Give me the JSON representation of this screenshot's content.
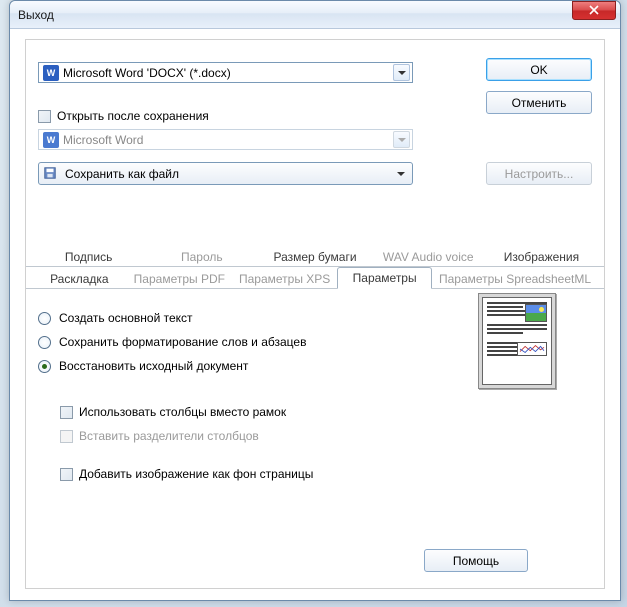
{
  "window": {
    "title": "Выход"
  },
  "buttons": {
    "ok": "OK",
    "cancel": "Отменить",
    "configure": "Настроить...",
    "help": "Помощь"
  },
  "format_dropdown": {
    "icon": "word-docx-icon",
    "text": "Microsoft Word 'DOCX' (*.docx)"
  },
  "open_after_save": {
    "label": "Открыть после сохранения",
    "checked": false
  },
  "application_dropdown": {
    "icon": "word-app-icon",
    "text": "Microsoft Word",
    "enabled": false
  },
  "save_action": {
    "icon": "disk-icon",
    "text": "Сохранить как файл"
  },
  "tabs_row1": [
    {
      "label": "Подпись",
      "enabled": true
    },
    {
      "label": "Пароль",
      "enabled": false
    },
    {
      "label": "Размер бумаги",
      "enabled": true
    },
    {
      "label": "WAV Audio voice",
      "enabled": false
    },
    {
      "label": "Изображения",
      "enabled": true
    }
  ],
  "tabs_row2": [
    {
      "label": "Раскладка",
      "enabled": true
    },
    {
      "label": "Параметры PDF",
      "enabled": false
    },
    {
      "label": "Параметры XPS",
      "enabled": false
    },
    {
      "label": "Параметры",
      "enabled": true,
      "active": true
    },
    {
      "label": "Параметры SpreadsheetML",
      "enabled": false
    }
  ],
  "options": {
    "radio1": "Создать основной текст",
    "radio2": "Сохранить форматирование слов и абзацев",
    "radio3": "Восстановить исходный документ",
    "selected": 3,
    "chk_columns": {
      "label": "Использовать столбцы вместо рамок",
      "checked": false,
      "enabled": true
    },
    "chk_separators": {
      "label": "Вставить разделители столбцов",
      "checked": false,
      "enabled": false
    },
    "chk_bgimage": {
      "label": "Добавить изображение как фон страницы",
      "checked": false,
      "enabled": true
    }
  }
}
